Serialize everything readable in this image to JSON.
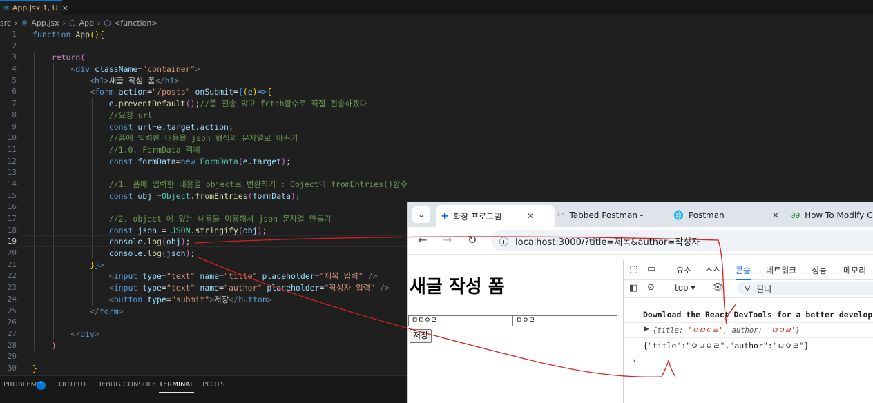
{
  "editor": {
    "tab": {
      "label": "App.jsx 1, U",
      "close": "×"
    },
    "breadcrumb": [
      "src",
      "App.jsx",
      "App",
      "<function>"
    ],
    "line_numbers": [
      "1",
      "2",
      "3",
      "4",
      "5",
      "6",
      "7",
      "8",
      "9",
      "10",
      "11",
      "12",
      "13",
      "14",
      "15",
      "16",
      "17",
      "18",
      "19",
      "20",
      "21",
      "22",
      "23",
      "24",
      "25",
      "26",
      "27",
      "28",
      "29",
      "30"
    ],
    "current_line": "19"
  },
  "panel": {
    "tabs": [
      "PROBLEMS",
      "OUTPUT",
      "DEBUG CONSOLE",
      "TERMINAL",
      "PORTS"
    ],
    "problems_count": "1",
    "active": "TERMINAL"
  },
  "browser": {
    "tabs": [
      "확장 프로그램",
      "Tabbed Postman -",
      "Postman",
      "How To Modify C"
    ],
    "url": "localhost:3000/?title=제목&author=작성자",
    "page": {
      "heading": "새글 작성 폼",
      "title_value": "ㅁㅁㅇㄹ",
      "author_value": "ㅁㅇㄹ",
      "button": "저장"
    },
    "devtools": {
      "tabs": [
        "요소",
        "소스",
        "콘솔",
        "네트워크",
        "성능",
        "메모리"
      ],
      "active_tab": "콘솔",
      "context": "top ▾",
      "filter_placeholder": "필터",
      "messages": {
        "react_tip": "Download the React DevTools for a better develop",
        "object_prefix": "{",
        "title_key": "title",
        "title_val": "'ㅇㅁㅇㄹ'",
        "author_key": "author",
        "author_val": "'ㅁㅇㄹ'",
        "object_suffix": "}",
        "json_line": "{\"title\":\"ㅇㅁㅇㄹ\",\"author\":\"ㅁㅇㄹ\"}",
        "prompt": "›"
      }
    }
  },
  "annotation_color": "#d42020"
}
